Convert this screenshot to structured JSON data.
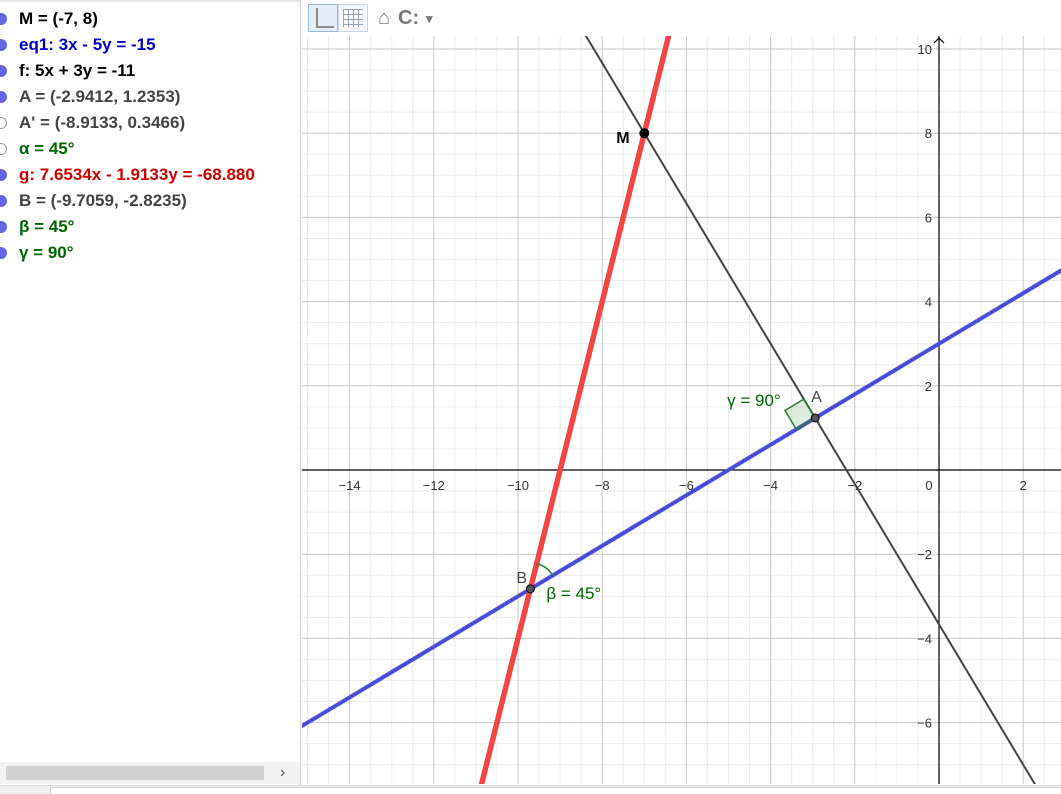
{
  "algebra": {
    "items": [
      {
        "text": "M = (-7, 8)",
        "color": "#000000",
        "dot": "#6464e6",
        "visible": true
      },
      {
        "text": "eq1: 3x - 5y = -15",
        "color": "#0000cc",
        "dot": "#6464e6",
        "visible": true
      },
      {
        "text": "f: 5x + 3y = -11",
        "color": "#000000",
        "dot": "#6464e6",
        "visible": true
      },
      {
        "text": "A = (-2.9412, 1.2353)",
        "color": "#444444",
        "dot": "#6464e6",
        "visible": true
      },
      {
        "text": "A' = (-8.9133, 0.3466)",
        "color": "#444444",
        "dot": "#ffffff",
        "visible": false
      },
      {
        "text": "α = 45°",
        "color": "#006400",
        "dot": "#ffffff",
        "visible": false
      },
      {
        "text": "g: 7.6534x - 1.9133y = -68.880",
        "color": "#cc0000",
        "dot": "#6464e6",
        "visible": true
      },
      {
        "text": "B = (-9.7059, -2.8235)",
        "color": "#444444",
        "dot": "#6464e6",
        "visible": true
      },
      {
        "text": "β = 45°",
        "color": "#006400",
        "dot": "#6464e6",
        "visible": true
      },
      {
        "text": "γ = 90°",
        "color": "#006400",
        "dot": "#6464e6",
        "visible": true
      }
    ]
  },
  "toolbar": {
    "home_icon": "home-icon",
    "style_glyph": "C:",
    "style_caret": "▾",
    "scroll_arrow": "›"
  },
  "graphics": {
    "x_ticks": [
      -14,
      -12,
      -10,
      -8,
      -6,
      -4,
      -2,
      0,
      2
    ],
    "y_ticks": [
      10,
      8,
      6,
      4,
      2,
      -2,
      -4,
      -6
    ],
    "colors": {
      "eq1": "#4b4bdc",
      "f": "#444444",
      "g": "#f04646",
      "angle": "#2e7d32",
      "angle_label": "#006400",
      "axis": "#000000",
      "grid_major": "#c8c8c8",
      "grid_minor": "#ececec"
    },
    "lines": {
      "eq1": {
        "a": 3,
        "b": -5,
        "c": -15
      },
      "f": {
        "a": 5,
        "b": 3,
        "c": -11
      },
      "g": {
        "a": 7.6534,
        "b": -1.9133,
        "c": -68.88
      }
    },
    "points": [
      {
        "name": "M",
        "x": -7,
        "y": 8
      },
      {
        "name": "A",
        "x": -2.9412,
        "y": 1.2353
      },
      {
        "name": "B",
        "x": -9.7059,
        "y": -2.8235
      }
    ],
    "angle_labels": {
      "gamma": "γ = 90°",
      "beta": "β = 45°"
    }
  }
}
